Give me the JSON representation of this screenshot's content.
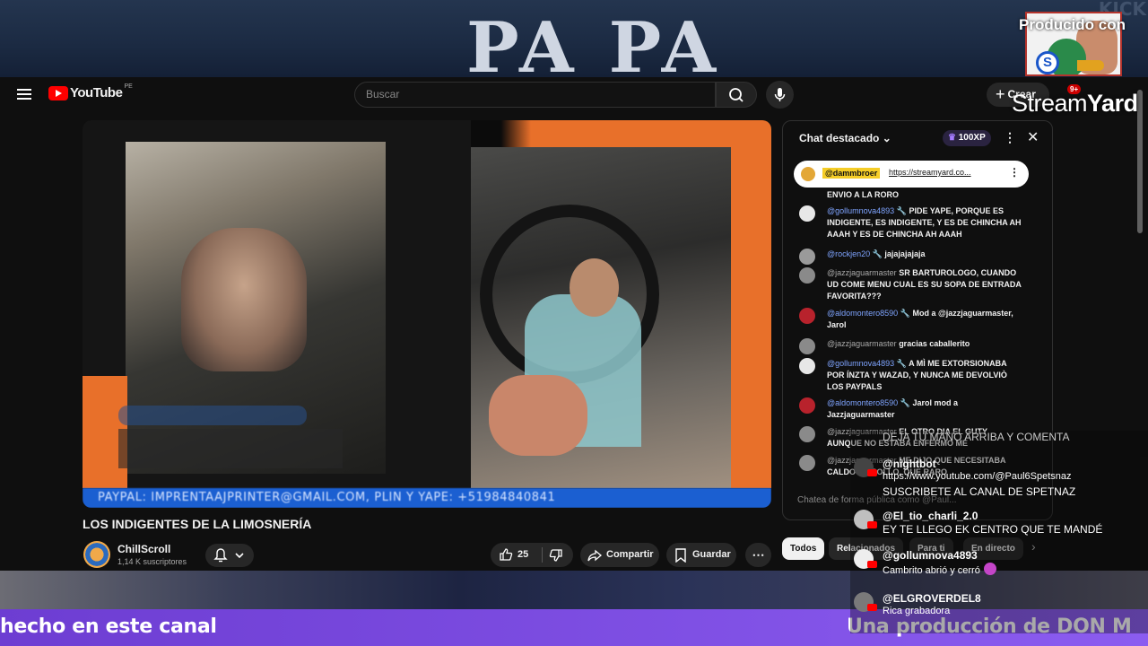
{
  "overlay_top": {
    "banner_text": "PA PA",
    "corner_text": "KICK",
    "producido": "Producido con",
    "streamyard_a": "Stream",
    "streamyard_b": "Yard",
    "logo_letter": "S"
  },
  "header": {
    "brand": "YouTube",
    "country": "PE",
    "search_placeholder": "Buscar",
    "create_label": "Crear",
    "notifications_badge": "9+"
  },
  "video": {
    "ticker": "PAYPAL: IMPRENTAAJPRINTER@GMAIL.COM, PLIN Y YAPE: +51984840841",
    "title": "LOS INDIGENTES DE LA LIMOSNERÍA",
    "channel": "ChillScroll",
    "subscribers": "1,14 K suscriptores",
    "likes": "25",
    "share_label": "Compartir",
    "save_label": "Guardar"
  },
  "chat": {
    "title": "Chat destacado",
    "xp": "100XP",
    "pinned_author": "@dammbroer",
    "pinned_link": "https://streamyard.co...",
    "input_placeholder": "Chatea de forma pública como @Paul...",
    "messages": [
      {
        "author": "",
        "text": "ENVIO A LA RORO"
      },
      {
        "author": "@gollumnova4893",
        "text": "PIDE YAPE, PORQUE ES INDIGENTE, ES INDIGENTE, Y ES DE CHINCHA AH AAAH Y ES DE CHINCHA AH AAAH"
      },
      {
        "author": "@rockjen20",
        "text": "jajajajajaja"
      },
      {
        "author": "@jazzjaguarmaster",
        "text": "SR BARTUROLOGO, CUANDO UD COME MENU CUAL ES SU SOPA DE ENTRADA FAVORITA???"
      },
      {
        "author": "@aldomontero8590",
        "text": "Mod a @jazzjaguarmaster, Jarol"
      },
      {
        "author": "@jazzjaguarmaster",
        "text": "gracias caballerito"
      },
      {
        "author": "@gollumnova4893",
        "text": "A MÌ ME EXTORSIONABA POR ÍNZTA Y WAZAD, Y NUNCA ME DEVOLVIÒ LOS PAYPALS"
      },
      {
        "author": "@aldomontero8590",
        "text": "Jarol mod a Jazzjaguarmaster"
      },
      {
        "author": "@jazzjaguarmaster",
        "text": "EL OTRO DIA EL GUTY AUNQUE NO ESTABA ENFERMO ME"
      },
      {
        "author": "@jazzjaguarmaster",
        "text": "ME DIJO QUE NECESITABA CALDO DE POLLO, QUE RARO"
      }
    ]
  },
  "chips": [
    "Todos",
    "Relacionados",
    "Para ti",
    "En directo"
  ],
  "overlay_comments": {
    "hint": "DEJA TU MANO ARRIBA Y COMENTA",
    "items": [
      {
        "name": "@nightbot",
        "text": "https://www.youtube.com/@Paul6Spetsnaz",
        "text2": "SUSCRIBETE AL CANAL DE SPETNAZ"
      },
      {
        "name": "@El_tio_charli_2.0",
        "text": "EY TE LLEGO EK CENTRO QUE TE MANDÉ"
      },
      {
        "name": "@gollumnova4893",
        "text": "Cambrito abrió y cerró"
      },
      {
        "name": "@ELGROVERDEL8",
        "text": "Rica grabadora"
      }
    ]
  },
  "bottom": {
    "ticker_left": "hecho en este canal",
    "ticker_right": "Una producción de DON M"
  }
}
